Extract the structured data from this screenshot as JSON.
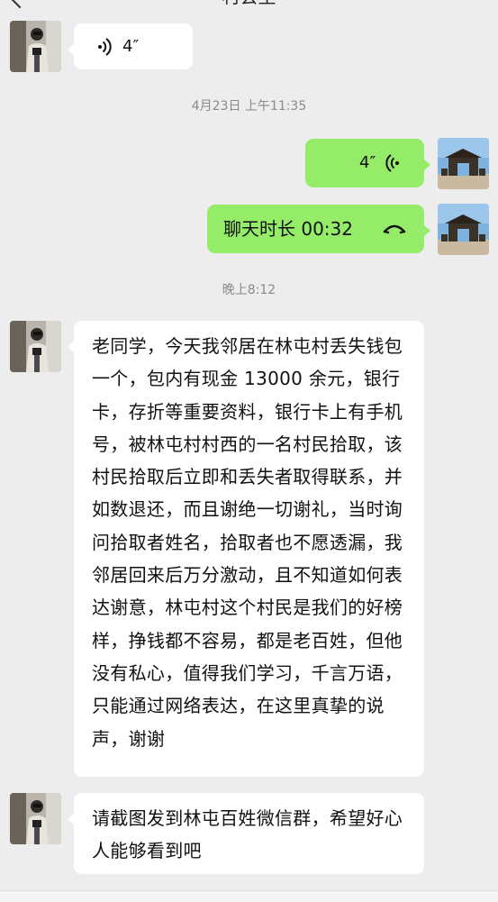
{
  "header": {
    "title": "村会里",
    "back_icon": "chevron-left-icon"
  },
  "colors": {
    "background": "#ededed",
    "incoming_bubble": "#ffffff",
    "outgoing_bubble": "#95ec69",
    "timestamp_text": "#8a8a8a"
  },
  "messages": {
    "m1": {
      "type": "voice",
      "direction": "incoming",
      "duration": "4″",
      "icon": "voice-wave-icon"
    },
    "ts1": "4月23日 上午11:35",
    "m2": {
      "type": "voice",
      "direction": "outgoing",
      "duration": "4″",
      "icon": "voice-wave-icon"
    },
    "m3": {
      "type": "call",
      "direction": "outgoing",
      "text": "聊天时长 00:32",
      "icon": "phone-hangup-icon"
    },
    "ts2": "晚上8:12",
    "m4": {
      "type": "text",
      "direction": "incoming",
      "text": "老同学，今天我邻居在林屯村丢失钱包一个，包内有现金 13000 余元，银行卡，存折等重要资料，银行卡上有手机号，被林屯村村西的一名村民拾取，该村民拾取后立即和丢失者取得联系，并如数退还，而且谢绝一切谢礼，当时询问拾取者姓名，拾取者也不愿透漏，我邻居回来后万分激动，且不知道如何表达谢意，林屯村这个村民是我们的好榜样，挣钱都不容易，都是老百姓，但他没有私心，值得我们学习，千言万语，只能通过网络表达，在这里真挚的说声，谢谢"
    },
    "m5": {
      "type": "text",
      "direction": "incoming",
      "text": "请截图发到林屯百姓微信群，希望好心人能够看到吧"
    }
  }
}
